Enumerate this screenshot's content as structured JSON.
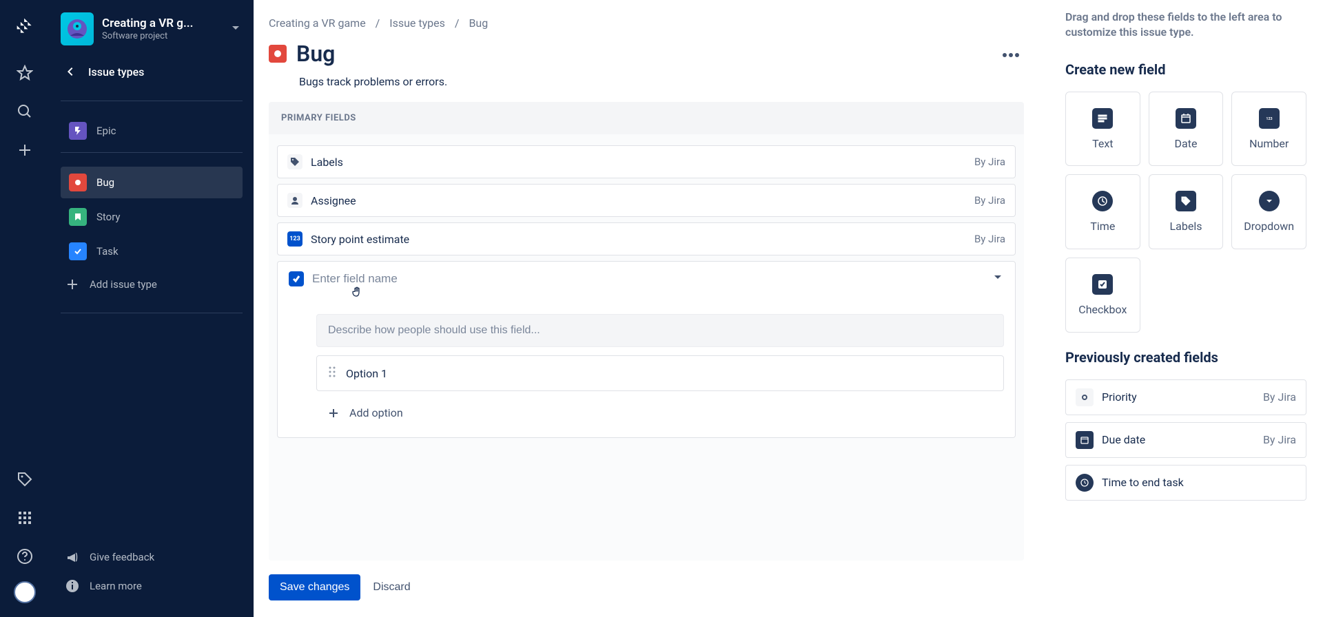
{
  "project": {
    "name": "Creating a VR g...",
    "subtitle": "Software project"
  },
  "sidebar": {
    "back_label": "Issue types",
    "items": [
      {
        "label": "Epic"
      },
      {
        "label": "Bug"
      },
      {
        "label": "Story"
      },
      {
        "label": "Task"
      }
    ],
    "add_label": "Add issue type",
    "feedback_label": "Give feedback",
    "learn_label": "Learn more"
  },
  "breadcrumbs": {
    "a": "Creating a VR game",
    "b": "Issue types",
    "c": "Bug"
  },
  "page": {
    "title": "Bug",
    "description": "Bugs track problems or errors.",
    "section_label": "PRIMARY FIELDS"
  },
  "fields": [
    {
      "label": "Labels",
      "meta": "By Jira"
    },
    {
      "label": "Assignee",
      "meta": "By Jira"
    },
    {
      "label": "Story point estimate",
      "meta": "By Jira"
    }
  ],
  "editor": {
    "name_placeholder": "Enter field name",
    "desc_placeholder": "Describe how people should use this field...",
    "option1": "Option 1",
    "add_option": "Add option"
  },
  "actions": {
    "save": "Save changes",
    "discard": "Discard"
  },
  "right": {
    "hint": "Drag and drop these fields to the left area to customize this issue type.",
    "create_h": "Create new field",
    "tiles": {
      "text": "Text",
      "date": "Date",
      "number": "Number",
      "time": "Time",
      "labels": "Labels",
      "dropdown": "Dropdown",
      "checkbox": "Checkbox"
    },
    "prev_h": "Previously created fields",
    "prev": [
      {
        "label": "Priority",
        "meta": "By Jira"
      },
      {
        "label": "Due date",
        "meta": "By Jira"
      },
      {
        "label": "Time to end task",
        "meta": ""
      }
    ]
  }
}
